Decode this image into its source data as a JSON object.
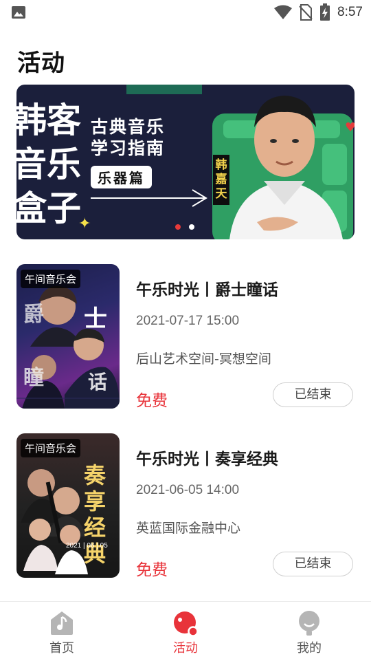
{
  "status_bar": {
    "time": "8:57"
  },
  "page": {
    "title": "活动"
  },
  "banner": {
    "big_text": [
      "韩客",
      "音乐",
      "盒子"
    ],
    "title_line1": "古典音乐",
    "title_line2": "学习指南",
    "subtitle": "乐器篇",
    "name_tag": [
      "韩",
      "嘉",
      "天"
    ],
    "current_slide": 1,
    "slide_count": 2
  },
  "events": [
    {
      "poster_tag": "午间音乐会",
      "poster_text": [
        "爵",
        "士",
        "瞳",
        "话"
      ],
      "title": "午乐时光丨爵士瞳话",
      "date": "2021-07-17 15:00",
      "place": "后山艺术空间-冥想空间",
      "price": "免费",
      "status": "已结束"
    },
    {
      "poster_tag": "午间音乐会",
      "poster_text": [
        "奏",
        "享",
        "经",
        "典"
      ],
      "poster_date": "2021 | 06 | 05",
      "title": "午乐时光丨奏享经典",
      "date": "2021-06-05 14:00",
      "place": "英蓝国际金融中心",
      "price": "免费",
      "status": "已结束"
    }
  ],
  "bottom_nav": [
    {
      "label": "首页",
      "icon": "home-music-icon",
      "active": false
    },
    {
      "label": "活动",
      "icon": "activity-icon",
      "active": true
    },
    {
      "label": "我的",
      "icon": "profile-icon",
      "active": false
    }
  ],
  "colors": {
    "accent": "#e8333a",
    "banner_bg": "#1b1f3b",
    "banner_green": "#2f9f63"
  }
}
